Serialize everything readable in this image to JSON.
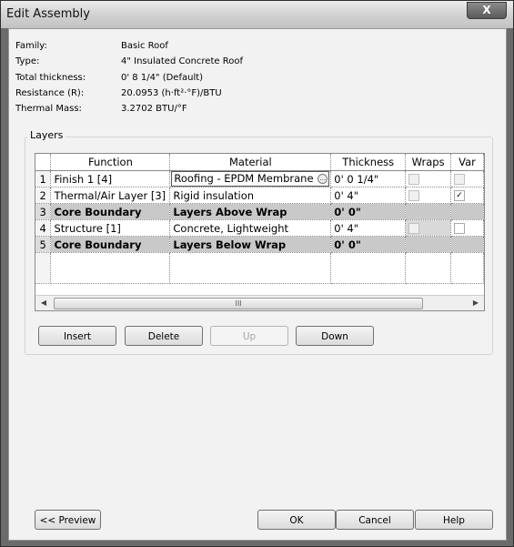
{
  "window": {
    "title": "Edit Assembly",
    "close_label": "X"
  },
  "properties": [
    {
      "label": "Family:",
      "value": "Basic Roof"
    },
    {
      "label": "Type:",
      "value": "4\" Insulated Concrete Roof"
    },
    {
      "label": "Total thickness:",
      "value": "0'  8 1/4\" (Default)"
    },
    {
      "label": "Resistance (R):",
      "value": "20.0953 (h·ft²·°F)/BTU"
    },
    {
      "label": "Thermal Mass:",
      "value": "3.2702 BTU/°F"
    }
  ],
  "layers": {
    "legend": "Layers",
    "headers": [
      "Function",
      "Material",
      "Thickness",
      "Wraps",
      "Var"
    ],
    "rows": [
      {
        "num": "1",
        "function": "Finish 1 [4]",
        "material": "Roofing - EPDM Membrane",
        "thickness": "0'  0 1/4\"",
        "wraps": false,
        "var": false
      },
      {
        "num": "2",
        "function": "Thermal/Air Layer [3]",
        "material": "Rigid insulation",
        "thickness": "0'  4\"",
        "wraps": false,
        "var": true
      },
      {
        "num": "3",
        "function": "Core Boundary",
        "material": "Layers Above Wrap",
        "thickness": "0'  0\""
      },
      {
        "num": "4",
        "function": "Structure [1]",
        "material": "Concrete, Lightweight",
        "thickness": "0'  4\"",
        "wraps": false,
        "var": false
      },
      {
        "num": "5",
        "function": "Core Boundary",
        "material": "Layers Below Wrap",
        "thickness": "0'  0\""
      }
    ],
    "scroll_grip": "III"
  },
  "actions": {
    "insert": "Insert",
    "delete": "Delete",
    "up": "Up",
    "down": "Down"
  },
  "footer": {
    "preview": "<< Preview",
    "ok": "OK",
    "cancel": "Cancel",
    "help": "Help"
  },
  "icons": {
    "browse": "browse-ellipsis-icon",
    "scroll_left": "arrow-left-icon",
    "scroll_right": "arrow-right-icon",
    "check": "checkmark-icon"
  }
}
